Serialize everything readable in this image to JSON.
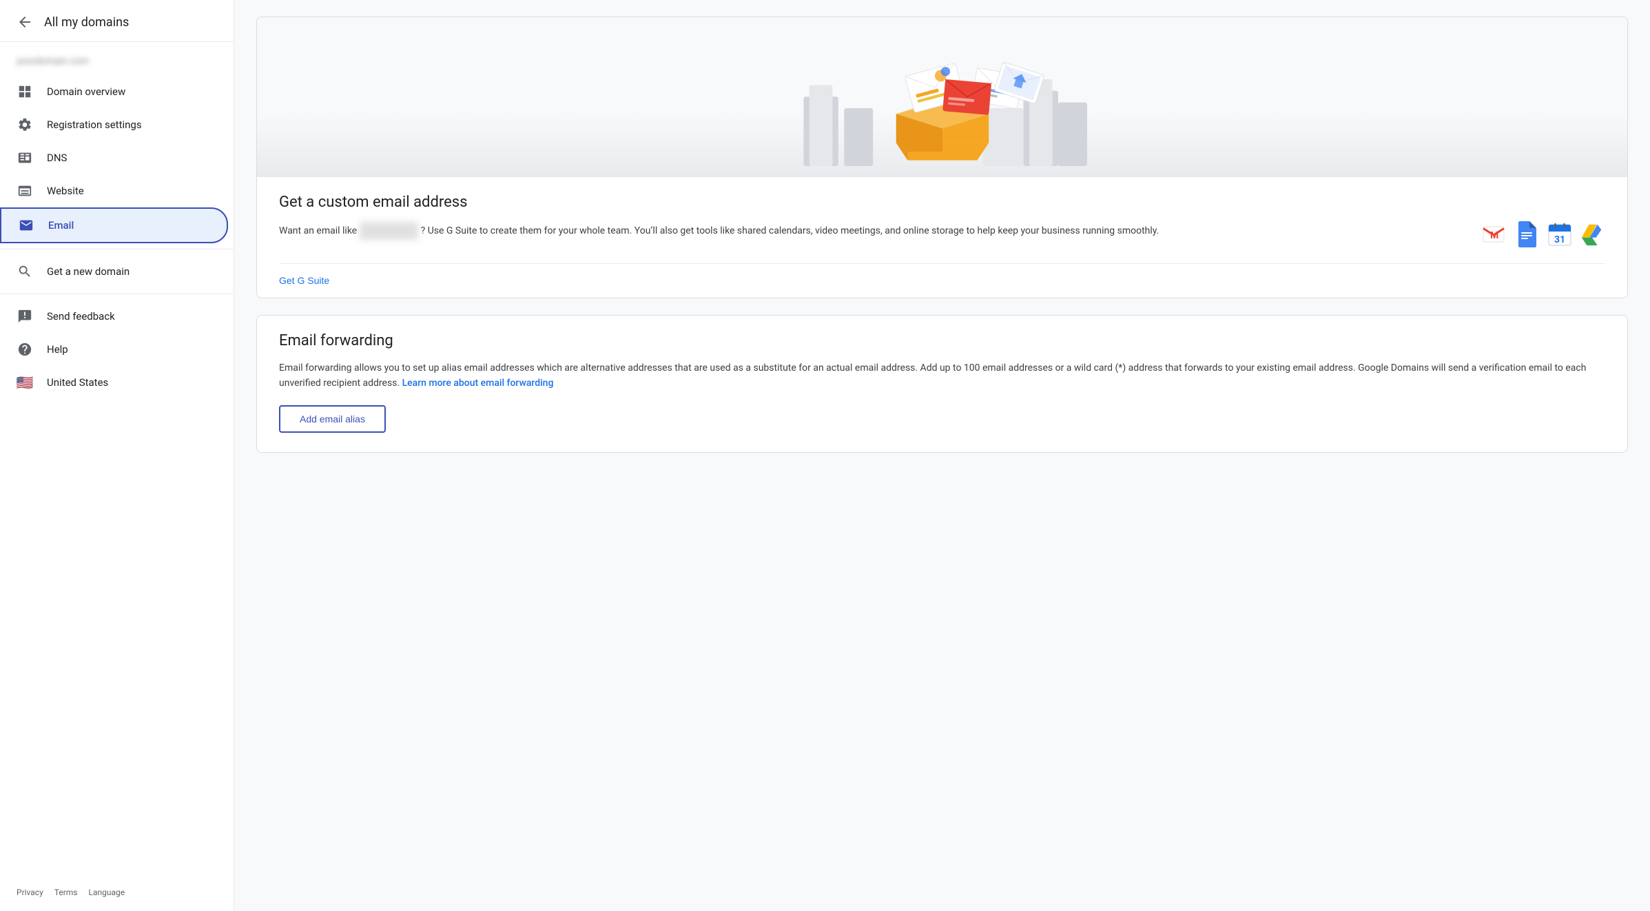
{
  "sidebar": {
    "back_label": "All my domains",
    "domain_name_blurred": "domain-blurred.com",
    "nav_items": [
      {
        "id": "domain-overview",
        "label": "Domain overview",
        "icon": "grid"
      },
      {
        "id": "registration-settings",
        "label": "Registration settings",
        "icon": "settings"
      },
      {
        "id": "dns",
        "label": "DNS",
        "icon": "dns"
      },
      {
        "id": "website",
        "label": "Website",
        "icon": "website"
      },
      {
        "id": "email",
        "label": "Email",
        "icon": "email",
        "active": true
      }
    ],
    "secondary_nav": [
      {
        "id": "get-new-domain",
        "label": "Get a new domain",
        "icon": "search"
      }
    ],
    "tertiary_nav": [
      {
        "id": "send-feedback",
        "label": "Send feedback",
        "icon": "feedback"
      },
      {
        "id": "help",
        "label": "Help",
        "icon": "help"
      },
      {
        "id": "united-states",
        "label": "United States",
        "icon": "flag"
      }
    ],
    "footer_links": [
      "Privacy",
      "Terms",
      "Language"
    ]
  },
  "main": {
    "custom_email_card": {
      "title": "Get a custom email address",
      "description_part1": "Want an email like",
      "description_blurred": "youremail@yourdomain.com",
      "description_part2": "? Use G Suite to create them for your whole team. You’ll also get tools like shared calendars, video meetings, and online storage to help keep your business running smoothly.",
      "get_gsuite_label": "Get G Suite"
    },
    "forwarding_card": {
      "title": "Email forwarding",
      "description": "Email forwarding allows you to set up alias email addresses which are alternative addresses that are used as a substitute for an actual email address. Add up to 100 email addresses or a wild card (*) address that forwards to your existing email address. Google Domains will send a verification email to each unverified recipient address.",
      "learn_more_label": "Learn more about email forwarding",
      "add_alias_label": "Add email alias"
    }
  },
  "icons": {
    "gmail_color": "#EA4335",
    "docs_color": "#4285F4",
    "calendar_color": "#1A73E8",
    "drive_color": "#FBBC05"
  }
}
